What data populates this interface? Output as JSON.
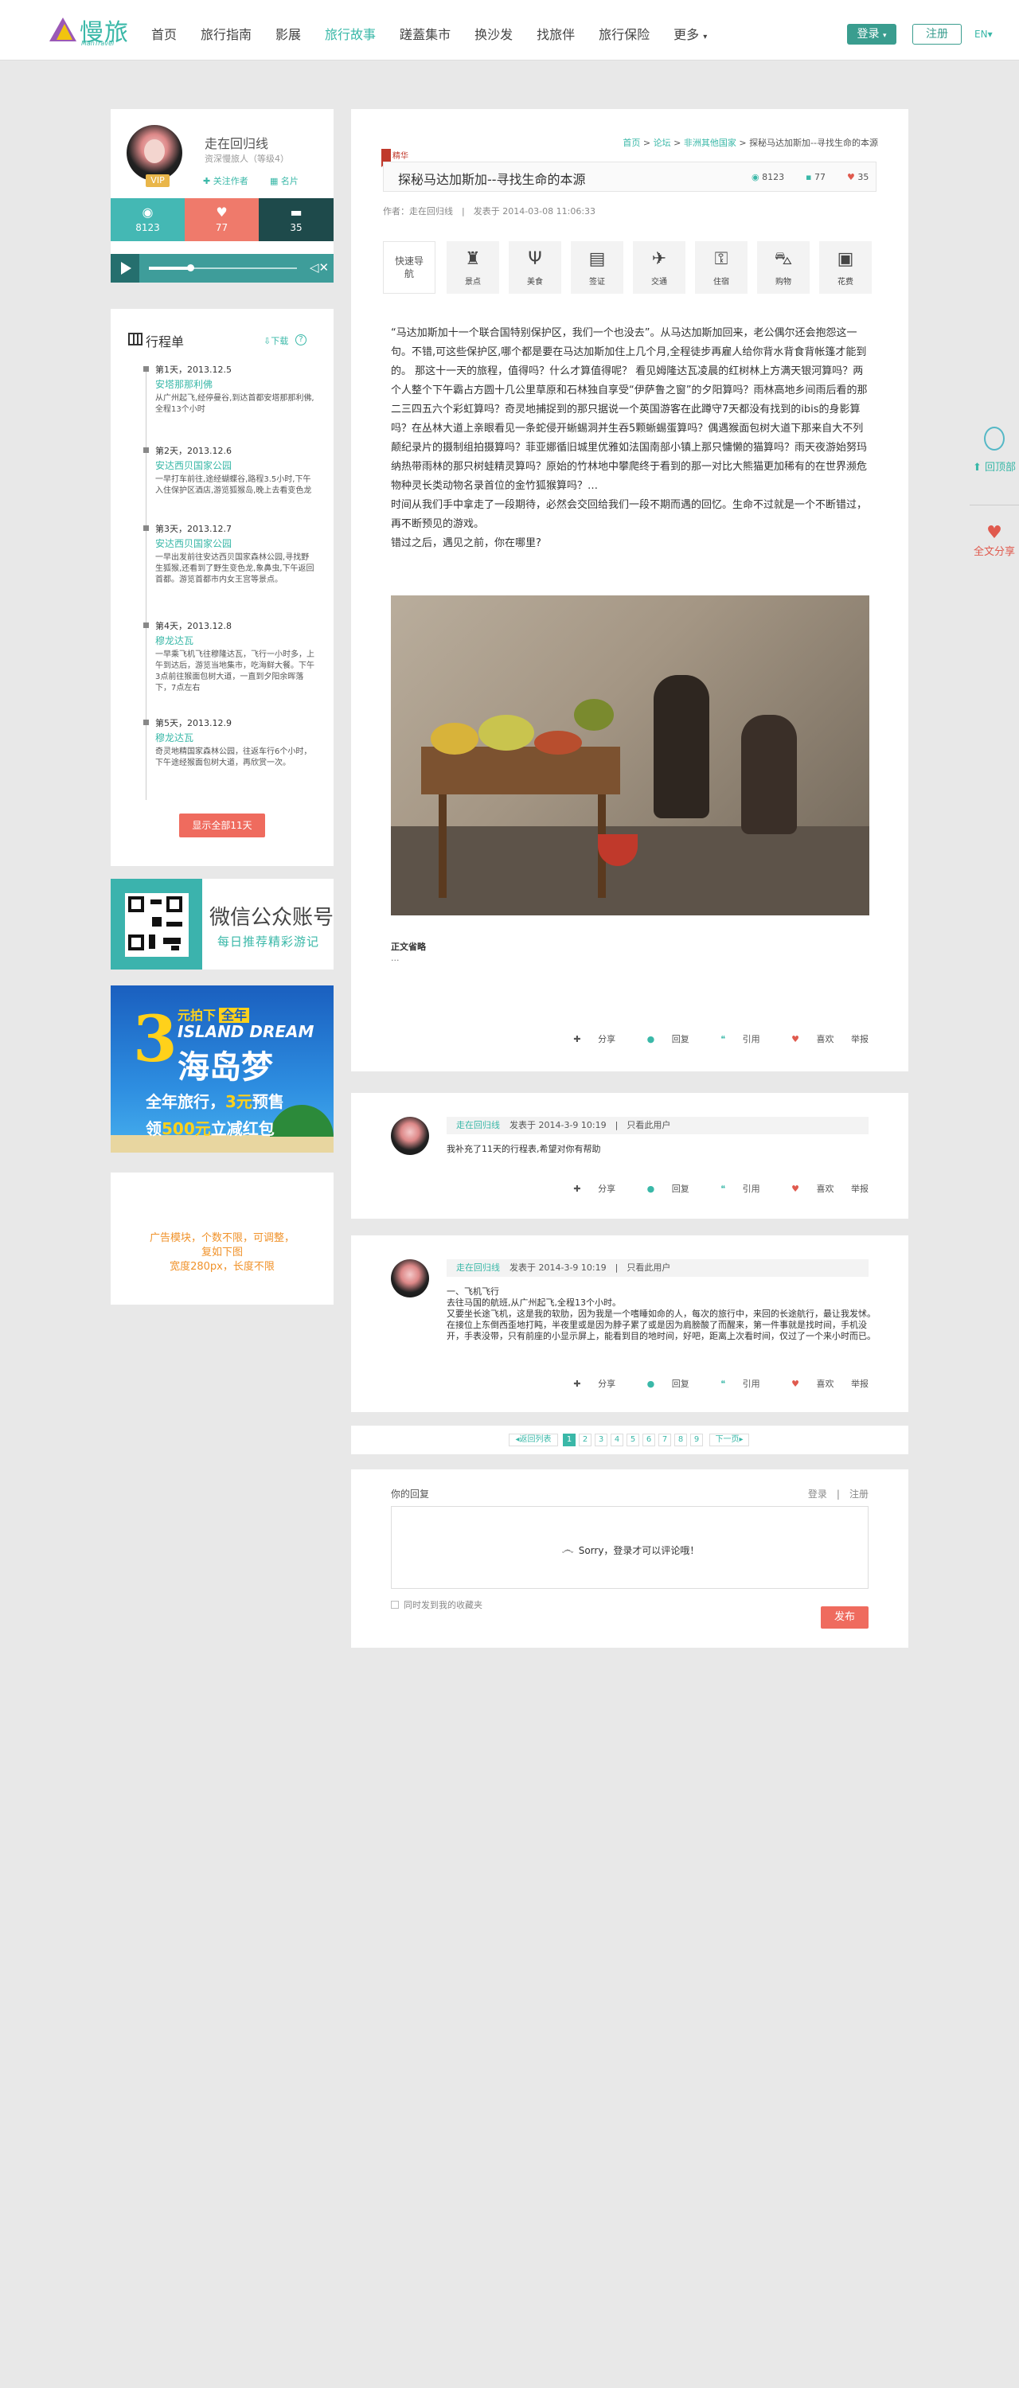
{
  "header": {
    "logo_text": "慢旅",
    "logo_sub": "ManTravel",
    "nav": [
      {
        "label": "首页"
      },
      {
        "label": "旅行指南"
      },
      {
        "label": "影展"
      },
      {
        "label": "旅行故事"
      },
      {
        "label": "蹉蓋集市"
      },
      {
        "label": "换沙发"
      },
      {
        "label": "找旅伴"
      },
      {
        "label": "旅行保险"
      },
      {
        "label": "更多"
      }
    ],
    "active_nav": "旅行故事",
    "login": "登录",
    "register": "注册",
    "lang": "EN"
  },
  "profile": {
    "name": "走在回归线",
    "level": "资深慢旅人（等级4）",
    "vip": "VIP",
    "follow": "关注作者",
    "card": "名片",
    "views": "8123",
    "likes": "77",
    "comments": "35",
    "player_progress": 0.28
  },
  "itinerary": {
    "title": "行程单",
    "download": "下载",
    "help": "?",
    "days": [
      {
        "title": "第1天，2013.12.5",
        "place": "安塔那那利佛",
        "desc": "从广州起飞,经停曼谷,到达首都安塔那那利佛,全程13个小时"
      },
      {
        "title": "第2天，2013.12.6",
        "place": "安达西贝国家公园",
        "desc": "一早打车前往,途经蝴蝶谷,路程3.5小时,下午入住保护区酒店,游览狐猴岛,晚上去看变色龙"
      },
      {
        "title": "第3天，2013.12.7",
        "place": "安达西贝国家公园",
        "desc": "一早出发前往安达西贝国家森林公园,寻找野生狐猴,还看到了野生变色龙,象鼻虫,下午返回首都。游览首都市内女王宫等景点。"
      },
      {
        "title": "第4天，2013.12.8",
        "place": "穆龙达瓦",
        "desc": "一早乘飞机飞往穆隆达瓦，飞行一小时多，上午到达后，游览当地集市，吃海鲜大餐。下午3点前往猴面包树大道，一直到夕阳余晖落下，7点左右"
      },
      {
        "title": "第5天，2013.12.9",
        "place": "穆龙达瓦",
        "desc": "奇灵地精国家森林公园，往返车行6个小时，下午途经猴面包树大道，再欣赏一次。"
      }
    ],
    "show_all": "显示全部11天"
  },
  "wechat": {
    "title": "微信公众账号",
    "subtitle": "每日推荐精彩游记"
  },
  "banner": {
    "big": "3",
    "line1": "元拍下",
    "line1b": "全年",
    "line2": "ISLAND DREAM",
    "line3": "海岛梦",
    "line4a": "全年旅行，",
    "line4b": "3元",
    "line4c": "预售",
    "line5a": "领",
    "line5b": "500元",
    "line5c": "立减红包"
  },
  "ad": {
    "line1": "广告模块，个数不限，可调整，",
    "line2": "复如下图",
    "line3": "宽度280px，长度不限"
  },
  "article": {
    "badge": "精华",
    "breadcrumb": {
      "home": "首页",
      "forum": "论坛",
      "section": "非洲其他国家",
      "current": "探秘马达加斯加--寻找生命的本源"
    },
    "title": "探秘马达加斯加--寻找生命的本源",
    "views": "8123",
    "comments": "77",
    "likes": "35",
    "author_label": "作者：走在回归线",
    "published": "发表于 2014-03-08 11:06:33",
    "quicknav_label": "快速导航",
    "quicknav": [
      {
        "icon": "tower-icon",
        "label": "景点"
      },
      {
        "icon": "fork-knife-icon",
        "label": "美食"
      },
      {
        "icon": "visa-icon",
        "label": "签证"
      },
      {
        "icon": "plane-icon",
        "label": "交通"
      },
      {
        "icon": "hotel-icon",
        "label": "住宿"
      },
      {
        "icon": "basket-icon",
        "label": "购物"
      },
      {
        "icon": "wallet-icon",
        "label": "花费"
      }
    ],
    "body": [
      "“马达加斯加十一个联合国特别保护区，我们一个也没去”。从马达加斯加回来，老公偶尔还会抱怨这一句。不错,可这些保护区,哪个都是要在马达加斯加住上几个月,全程徒步再雇人给你背水背食背帐篷才能到的。 那这十一天的旅程，值得吗？什么才算值得呢？ 看见姆隆达瓦凌晨的红树林上方满天银河算吗？两个人整个下午霸占方圆十几公里草原和石林独自享受“伊萨鲁之窗”的夕阳算吗？雨林高地乡间雨后看的那二三四五六个彩虹算吗？奇灵地捕捉到的那只据说一个英国游客在此蹲守7天都没有找到的ibis的身影算吗？在丛林大道上亲眼看见一条蛇侵开蜥蜴洞并生吞5颗蜥蜴蛋算吗？偶遇猴面包树大道下那来自大不列颠纪录片的摄制组拍摄算吗？菲亚娜循旧城里优雅如法国南部小镇上那只慵懒的猫算吗？雨天夜游始努玛纳热带雨林的那只树蛙精灵算吗？原始的竹林地中攀爬终于看到的那一对比大熊猫更加稀有的在世界濒危物种灵长类动物名录首位的金竹狐猴算吗？…",
      "时间从我们手中拿走了一段期待，必然会交回给我们一段不期而遇的回忆。生命不过就是一个不断错过，再不断预见的游戏。",
      "错过之后，遇见之前，你在哪里?"
    ],
    "excerpt_label": "正文省略",
    "excerpt_dots": "...",
    "actions": {
      "share": "分享",
      "reply": "回复",
      "quote": "引用",
      "like": "喜欢",
      "report": "举报"
    }
  },
  "comments": [
    {
      "name": "走在回归线",
      "time": "发表于 2014-3-9 10:19",
      "scope": "只看此用户",
      "text": "我补充了11天的行程表,希望对你有帮助"
    },
    {
      "name": "走在回归线",
      "time": "发表于 2014-3-9 10:19",
      "scope": "只看此用户",
      "text": "一、飞机飞行\n去往马国的航班,从广州起飞,全程13个小时。\n又要坐长途飞机，这是我的软肋，因为我是一个嗜睡如命的人，每次的旅行中，来回的长途航行，最让我发怵。在接位上东倒西歪地打盹，半夜里或是因为脖子累了或是因为肩膀酸了而醒来，第一件事就是找时间，手机没开，手表没带，只有前座的小显示屏上，能看到目的地时间，好吧，距离上次看时间，仅过了一个来小时而已。"
    }
  ],
  "pager": {
    "prev": "◂返回列表",
    "pages": [
      "1",
      "2",
      "3",
      "4",
      "5",
      "6",
      "7",
      "8",
      "9"
    ],
    "current": "1",
    "next": "下一页▸"
  },
  "reply": {
    "label": "你的回复",
    "login": "登录",
    "sep": "|",
    "register": "注册",
    "sorry": "Sorry，登录才可以评论哦！",
    "sync": "同时发到我的收藏夹",
    "publish": "发布"
  },
  "float": {
    "top": "回顶部",
    "share": "全文分享"
  },
  "colors": {
    "accent": "#3ab8a8",
    "red": "#ef6b5e",
    "dark": "#1e4a4b"
  }
}
